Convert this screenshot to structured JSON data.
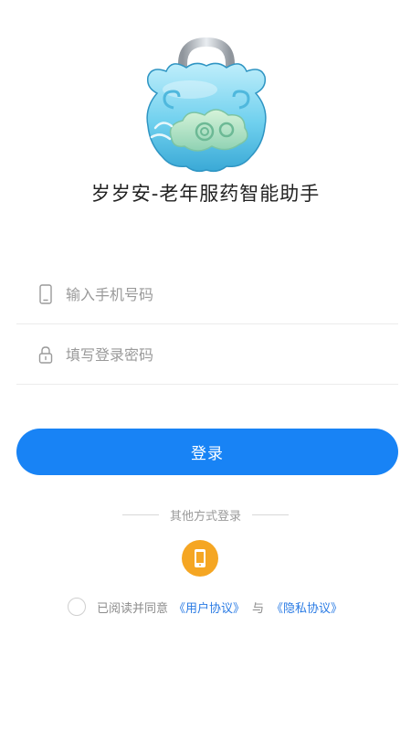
{
  "app": {
    "title": "岁岁安-老年服药智能助手"
  },
  "form": {
    "phone_placeholder": "输入手机号码",
    "password_placeholder": "填写登录密码",
    "login_label": "登录"
  },
  "other_login": {
    "label": "其他方式登录"
  },
  "agreement": {
    "prefix": "已阅读并同意",
    "user_agreement": "《用户协议》",
    "and": "与",
    "privacy_policy": "《隐私协议》"
  },
  "colors": {
    "primary": "#1883f5",
    "phone_login_bg": "#f5a623",
    "link": "#2a7be4"
  }
}
